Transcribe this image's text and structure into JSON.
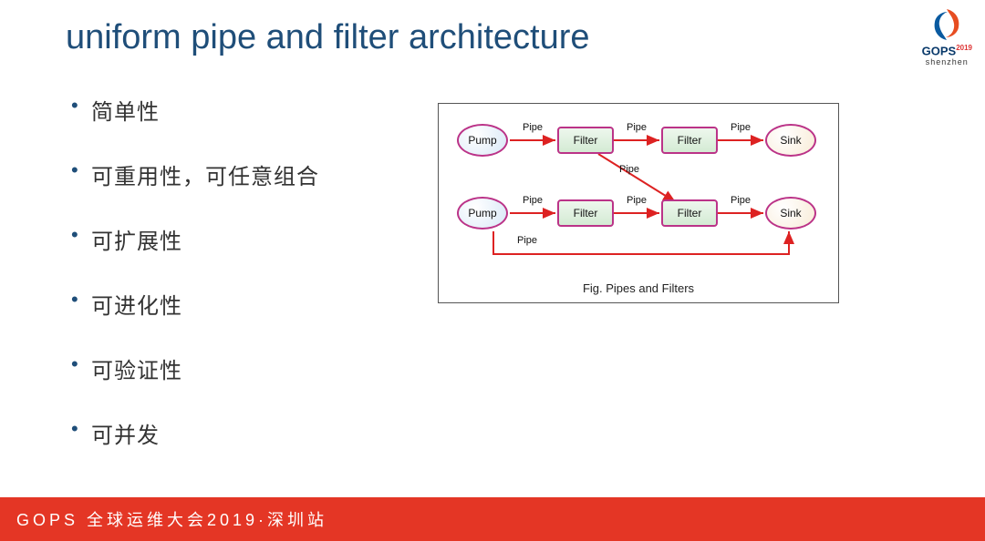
{
  "title": "uniform pipe and filter architecture",
  "bullets": [
    "简单性",
    "可重用性，可任意组合",
    "可扩展性",
    "可进化性",
    "可验证性",
    "可并发"
  ],
  "footer": "GOPS 全球运维大会2019·深圳站",
  "logo": {
    "brand": "GOPS",
    "year": "2019",
    "city": "shenzhen"
  },
  "diagram": {
    "caption": "Fig. Pipes and Filters",
    "nodes": {
      "pump1": "Pump",
      "pump2": "Pump",
      "filter1": "Filter",
      "filter2": "Filter",
      "filter3": "Filter",
      "filter4": "Filter",
      "sink1": "Sink",
      "sink2": "Sink"
    },
    "pipe_label": "Pipe"
  },
  "chart_data": {
    "type": "diagram",
    "title": "Fig. Pipes and Filters",
    "nodes": [
      {
        "id": "pump1",
        "type": "pump",
        "label": "Pump",
        "row": 1
      },
      {
        "id": "filter1",
        "type": "filter",
        "label": "Filter",
        "row": 1
      },
      {
        "id": "filter2",
        "type": "filter",
        "label": "Filter",
        "row": 1
      },
      {
        "id": "sink1",
        "type": "sink",
        "label": "Sink",
        "row": 1
      },
      {
        "id": "pump2",
        "type": "pump",
        "label": "Pump",
        "row": 2
      },
      {
        "id": "filter3",
        "type": "filter",
        "label": "Filter",
        "row": 2
      },
      {
        "id": "filter4",
        "type": "filter",
        "label": "Filter",
        "row": 2
      },
      {
        "id": "sink2",
        "type": "sink",
        "label": "Sink",
        "row": 2
      }
    ],
    "edges": [
      {
        "from": "pump1",
        "to": "filter1",
        "label": "Pipe"
      },
      {
        "from": "filter1",
        "to": "filter2",
        "label": "Pipe"
      },
      {
        "from": "filter2",
        "to": "sink1",
        "label": "Pipe"
      },
      {
        "from": "filter1",
        "to": "filter4",
        "label": "Pipe"
      },
      {
        "from": "pump2",
        "to": "filter3",
        "label": "Pipe"
      },
      {
        "from": "filter3",
        "to": "filter4",
        "label": "Pipe"
      },
      {
        "from": "filter4",
        "to": "sink2",
        "label": "Pipe"
      },
      {
        "from": "pump2",
        "to": "sink2",
        "label": "Pipe"
      }
    ]
  }
}
